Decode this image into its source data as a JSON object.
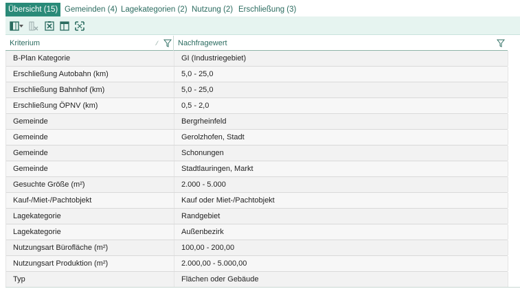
{
  "tabs": [
    {
      "label": "Übersicht (15)",
      "active": true
    },
    {
      "label": "Gemeinden (4)",
      "active": false
    },
    {
      "label": "Lagekategorien (2)",
      "active": false
    },
    {
      "label": "Nutzung (2)",
      "active": false
    },
    {
      "label": "Erschließung (3)",
      "active": false
    }
  ],
  "toolbar": {
    "icons": [
      "column-chooser-icon",
      "dropdown-arrow-icon",
      "clear-filter-icon",
      "export-excel-icon",
      "table-layout-icon",
      "fit-columns-icon"
    ]
  },
  "grid": {
    "columns": [
      "Kriterium",
      "Nachfragewert"
    ],
    "rows": [
      [
        "B-Plan Kategorie",
        "GI (Industriegebiet)"
      ],
      [
        "Erschließung Autobahn (km)",
        "5,0 - 25,0"
      ],
      [
        "Erschließung Bahnhof (km)",
        "5,0 - 25,0"
      ],
      [
        "Erschließung ÖPNV (km)",
        "0,5 - 2,0"
      ],
      [
        "Gemeinde",
        "Bergrheinfeld"
      ],
      [
        "Gemeinde",
        "Gerolzhofen, Stadt"
      ],
      [
        "Gemeinde",
        "Schonungen"
      ],
      [
        "Gemeinde",
        "Stadtlauringen, Markt"
      ],
      [
        "Gesuchte Größe (m²)",
        "2.000 - 5.000"
      ],
      [
        "Kauf-/Miet-/Pachtobjekt",
        "Kauf oder Miet-/Pachtobjekt"
      ],
      [
        "Lagekategorie",
        "Randgebiet"
      ],
      [
        "Lagekategorie",
        "Außenbezirk"
      ],
      [
        "Nutzungsart Bürofläche (m²)",
        "100,00 - 200,00"
      ],
      [
        "Nutzungsart Produktion (m²)",
        "2.000,00 - 5.000,00"
      ],
      [
        "Typ",
        "Flächen oder Gebäude"
      ]
    ]
  },
  "colors": {
    "accent": "#2a8a78",
    "tab_text": "#2a6b5f",
    "toolbar_bg": "#e6f4f0"
  }
}
